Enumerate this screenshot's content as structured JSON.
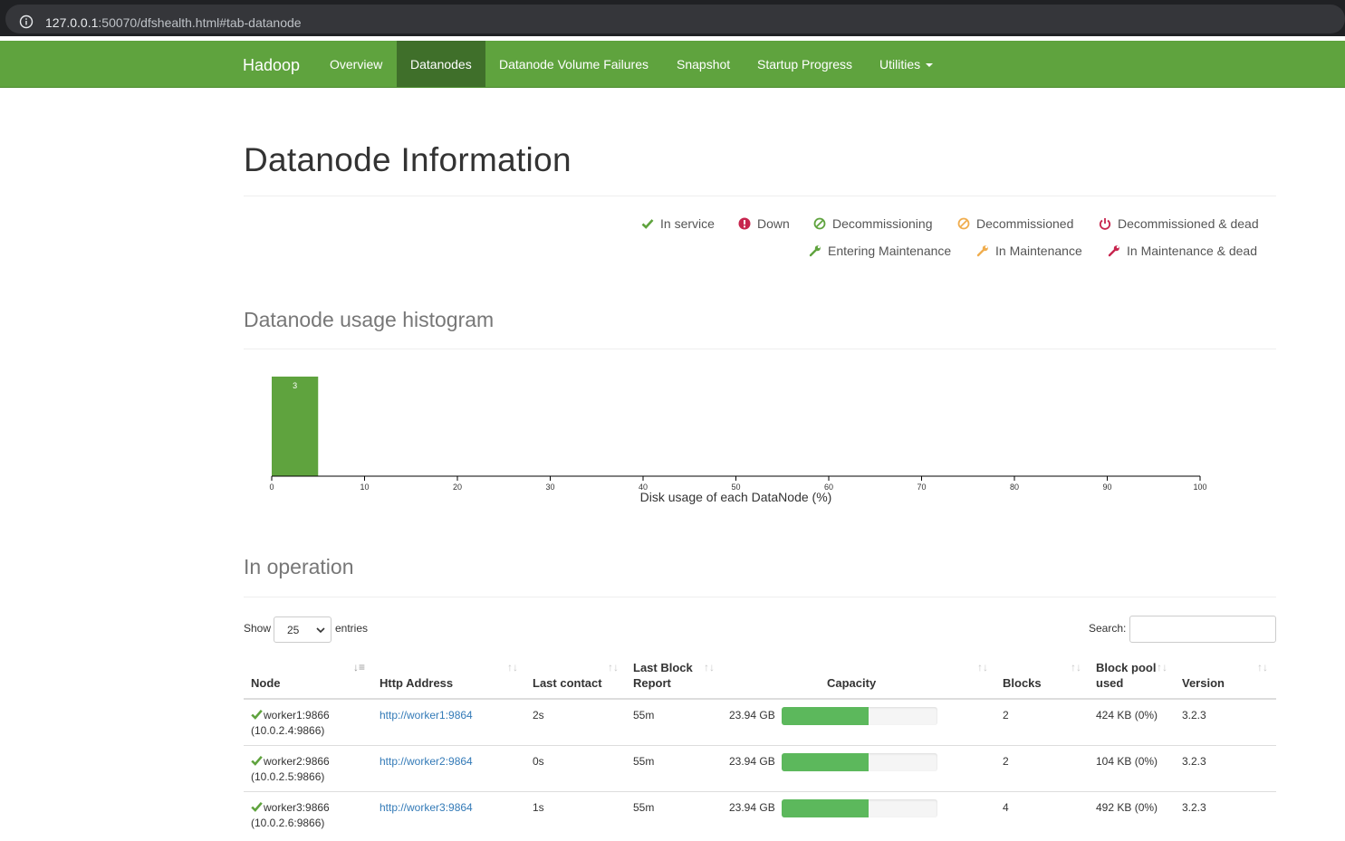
{
  "browser": {
    "url_host": "127.0.0.1",
    "url_rest": ":50070/dfshealth.html#tab-datanode"
  },
  "navbar": {
    "brand": "Hadoop",
    "items": [
      {
        "label": "Overview"
      },
      {
        "label": "Datanodes",
        "active": true
      },
      {
        "label": "Datanode Volume Failures"
      },
      {
        "label": "Snapshot"
      },
      {
        "label": "Startup Progress"
      },
      {
        "label": "Utilities"
      }
    ],
    "color": "#5fa33e",
    "active_color": "#3f6f2a"
  },
  "page": {
    "title": "Datanode Information"
  },
  "legend": [
    {
      "label": "In service",
      "icon": "check-icon",
      "color": "#5fa33e"
    },
    {
      "label": "Down",
      "icon": "exclamation-circle-icon",
      "color": "#c7254e"
    },
    {
      "label": "Decommissioning",
      "icon": "ban-icon",
      "color": "#5fa33e"
    },
    {
      "label": "Decommissioned",
      "icon": "ban-icon",
      "color": "#f0ad4e"
    },
    {
      "label": "Decommissioned & dead",
      "icon": "power-icon",
      "color": "#c7254e"
    },
    {
      "label": "Entering Maintenance",
      "icon": "wrench-icon",
      "color": "#5fa33e"
    },
    {
      "label": "In Maintenance",
      "icon": "wrench-icon",
      "color": "#f0ad4e"
    },
    {
      "label": "In Maintenance & dead",
      "icon": "wrench-icon",
      "color": "#c7254e"
    }
  ],
  "histogram": {
    "title": "Datanode usage histogram"
  },
  "chart_data": {
    "type": "bar",
    "xlabel": "Disk usage of each DataNode (%)",
    "xlim": [
      0,
      100
    ],
    "xticks": [
      0,
      10,
      20,
      30,
      40,
      50,
      60,
      70,
      80,
      90,
      100
    ],
    "bins": [
      {
        "x0": 0,
        "x1": 5,
        "count": 3
      }
    ],
    "bar_color": "#5fa33e"
  },
  "operation": {
    "title": "In operation",
    "show_label": "Show",
    "page_length": "25",
    "entries_label": "entries",
    "search_label": "Search:",
    "search_value": "",
    "columns": [
      "Node",
      "Http Address",
      "Last contact",
      "Last Block Report",
      "Capacity",
      "Blocks",
      "Block pool used",
      "Version"
    ],
    "rows": [
      {
        "node": "worker1:9866",
        "node_ip": "(10.0.2.4:9866)",
        "http": "http://worker1:9864",
        "last_contact": "2s",
        "last_block_report": "55m",
        "capacity": "23.94 GB",
        "capacity_used_fraction": 0.56,
        "blocks": "2",
        "block_pool_used": "424 KB (0%)",
        "version": "3.2.3"
      },
      {
        "node": "worker2:9866",
        "node_ip": "(10.0.2.5:9866)",
        "http": "http://worker2:9864",
        "last_contact": "0s",
        "last_block_report": "55m",
        "capacity": "23.94 GB",
        "capacity_used_fraction": 0.56,
        "blocks": "2",
        "block_pool_used": "104 KB (0%)",
        "version": "3.2.3"
      },
      {
        "node": "worker3:9866",
        "node_ip": "(10.0.2.6:9866)",
        "http": "http://worker3:9864",
        "last_contact": "1s",
        "last_block_report": "55m",
        "capacity": "23.94 GB",
        "capacity_used_fraction": 0.56,
        "blocks": "4",
        "block_pool_used": "492 KB (0%)",
        "version": "3.2.3"
      }
    ]
  }
}
